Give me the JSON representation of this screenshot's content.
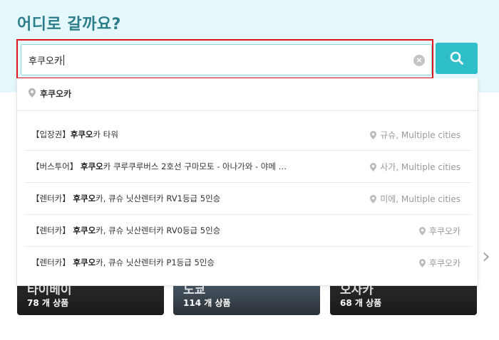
{
  "page": {
    "title": "어디로 갈까요?"
  },
  "search": {
    "value": "후쿠오카",
    "clear_icon": "close-circle-icon",
    "button_icon": "search-icon"
  },
  "suggestions": {
    "top": {
      "label": "후쿠오카"
    },
    "items": [
      {
        "prefix": "【입장권】",
        "bold": "후쿠오",
        "rest": "카 타워",
        "location": "규슈, Multiple cities"
      },
      {
        "prefix": "【버스투어】 ",
        "bold": "후쿠오",
        "rest": "카 쿠루쿠루버스 2호선 구마모토 - 아나가와 - 야메 …",
        "location": "사가, Multiple cities"
      },
      {
        "prefix": "【렌터카】 ",
        "bold": "후쿠오",
        "rest": "카, 큐슈 닛산렌터카 RV1등급 5인승",
        "location": "미에, Multiple cities"
      },
      {
        "prefix": "【렌터카】 ",
        "bold": "후쿠오",
        "rest": "카, 큐슈 닛산렌터카 RV0등급 5인승",
        "location": "후쿠오카"
      },
      {
        "prefix": "【렌터카】 ",
        "bold": "후쿠오",
        "rest": "카, 큐슈 닛산렌터카 P1등급 5인승",
        "location": "후쿠오카"
      }
    ]
  },
  "cards": [
    {
      "name": "타이베이",
      "count": "78 개 상품"
    },
    {
      "name": "도쿄",
      "count": "114 개 상품"
    },
    {
      "name": "오사카",
      "count": "68 개 상품"
    }
  ],
  "colors": {
    "title": "#2a7d89",
    "accent": "#2fbfc9",
    "highlight_border": "#e0141e"
  }
}
